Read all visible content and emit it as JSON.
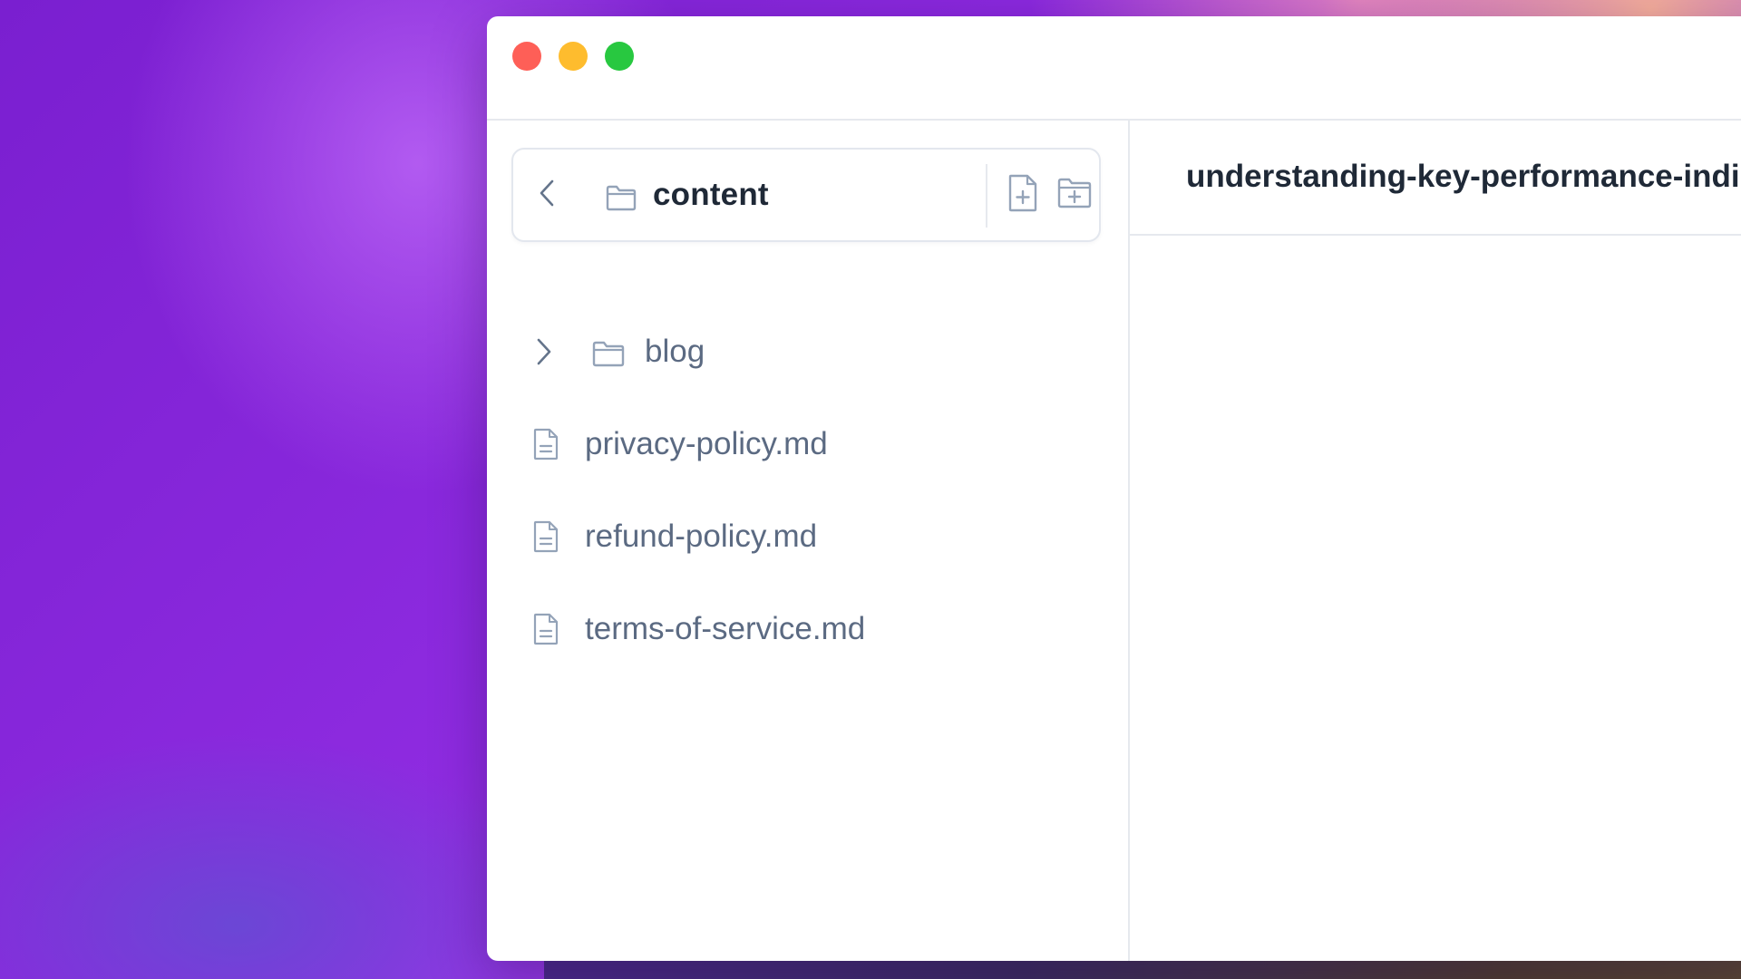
{
  "colors": {
    "close": "#fe5f57",
    "minimize": "#febc2e",
    "zoom": "#28c840",
    "icon_stroke": "#94a3b8",
    "text_primary": "#1f2937",
    "text_secondary": "#5b6a82"
  },
  "window": {
    "traffic_lights": [
      "close",
      "minimize",
      "zoom"
    ]
  },
  "sidebar": {
    "header": {
      "back_icon": "chevron-left-icon",
      "folder_icon": "folder-icon",
      "title": "content",
      "new_file_icon": "file-plus-icon",
      "new_folder_icon": "folder-plus-icon"
    },
    "items": [
      {
        "type": "folder",
        "label": "blog",
        "icon": "folder-icon",
        "expanded": false
      },
      {
        "type": "file",
        "label": "privacy-policy.md",
        "icon": "file-text-icon"
      },
      {
        "type": "file",
        "label": "refund-policy.md",
        "icon": "file-text-icon"
      },
      {
        "type": "file",
        "label": "terms-of-service.md",
        "icon": "file-text-icon"
      }
    ]
  },
  "editor": {
    "title": "understanding-key-performance-indi"
  }
}
